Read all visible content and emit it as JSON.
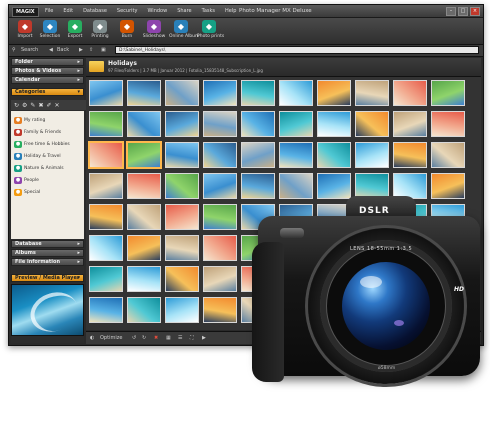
{
  "window": {
    "title": "Photo Manager MX Deluxe",
    "logo": "MAGIX"
  },
  "menu": [
    "File",
    "Edit",
    "Database",
    "Security",
    "Window",
    "Share",
    "Tasks",
    "Help"
  ],
  "toolbar": [
    {
      "label": "Import",
      "icon": "import-icon",
      "color": "#c0392b"
    },
    {
      "label": "Selection",
      "icon": "selection-icon",
      "color": "#2e86c1"
    },
    {
      "label": "Export",
      "icon": "export-icon",
      "color": "#27ae60"
    },
    {
      "label": "Printing",
      "icon": "printer-icon",
      "color": "#7f8c8d"
    },
    {
      "label": "Burn",
      "icon": "burn-disc-icon",
      "color": "#d35400"
    },
    {
      "label": "Slideshow",
      "icon": "slideshow-icon",
      "color": "#8e44ad"
    },
    {
      "label": "Online Album",
      "icon": "online-album-icon",
      "color": "#2980b9"
    },
    {
      "label": "Photo prints",
      "icon": "photo-prints-icon",
      "color": "#16a085"
    }
  ],
  "nav": {
    "search": "Search",
    "back": "Back",
    "path": "D:\\Sabine\\_Holidays\\"
  },
  "sidebar": {
    "panels": [
      "Folder",
      "Photos & Videos",
      "Calendar",
      "Categories"
    ],
    "categories": [
      {
        "label": "My rating",
        "color": "#e67e22"
      },
      {
        "label": "Family & Friends",
        "color": "#c0392b"
      },
      {
        "label": "Free time & Hobbies",
        "color": "#27ae60"
      },
      {
        "label": "Holiday & Travel",
        "color": "#2980b9"
      },
      {
        "label": "Nature & Animals",
        "color": "#16a085"
      },
      {
        "label": "People",
        "color": "#8e44ad"
      },
      {
        "label": "Special",
        "color": "#f39c12"
      }
    ],
    "lower_panels": [
      "Database",
      "Albums",
      "File information",
      "Preview / Media Player"
    ]
  },
  "folder": {
    "title": "Holidays",
    "info": "97 Files/Folders | 3.7 MB | Januar 2012 | Fotolia_15835148_Subscription_L.jpg"
  },
  "statusbar": {
    "optimize": "Optimize"
  },
  "camera": {
    "brand": "DSLR",
    "lens": "LENS 18-55mm 1:3.5",
    "hd": "HD",
    "diameter": "ø58mm"
  },
  "thumb_palettes": [
    [
      "#7fc6ef",
      "#3a8fd0",
      "#e9d7a8"
    ],
    [
      "#1f6fb5",
      "#59b3e6",
      "#f1e3bb"
    ],
    [
      "#f28a2e",
      "#f6c05a",
      "#2a3d5c"
    ],
    [
      "#57a54a",
      "#8fd46b",
      "#3f7fcf"
    ],
    [
      "#d9d2c4",
      "#6fa0c8",
      "#c9b089"
    ],
    [
      "#2d9bd7",
      "#a7e3f7",
      "#ffffff"
    ],
    [
      "#e75c4a",
      "#f2a98e",
      "#f5e6d0"
    ],
    [
      "#2b5d8f",
      "#5aa9dc",
      "#f0d492"
    ],
    [
      "#0f8f9c",
      "#50c9d4",
      "#e6d5b0"
    ],
    [
      "#bfa27a",
      "#e8d7b8",
      "#5a7fa0"
    ]
  ]
}
